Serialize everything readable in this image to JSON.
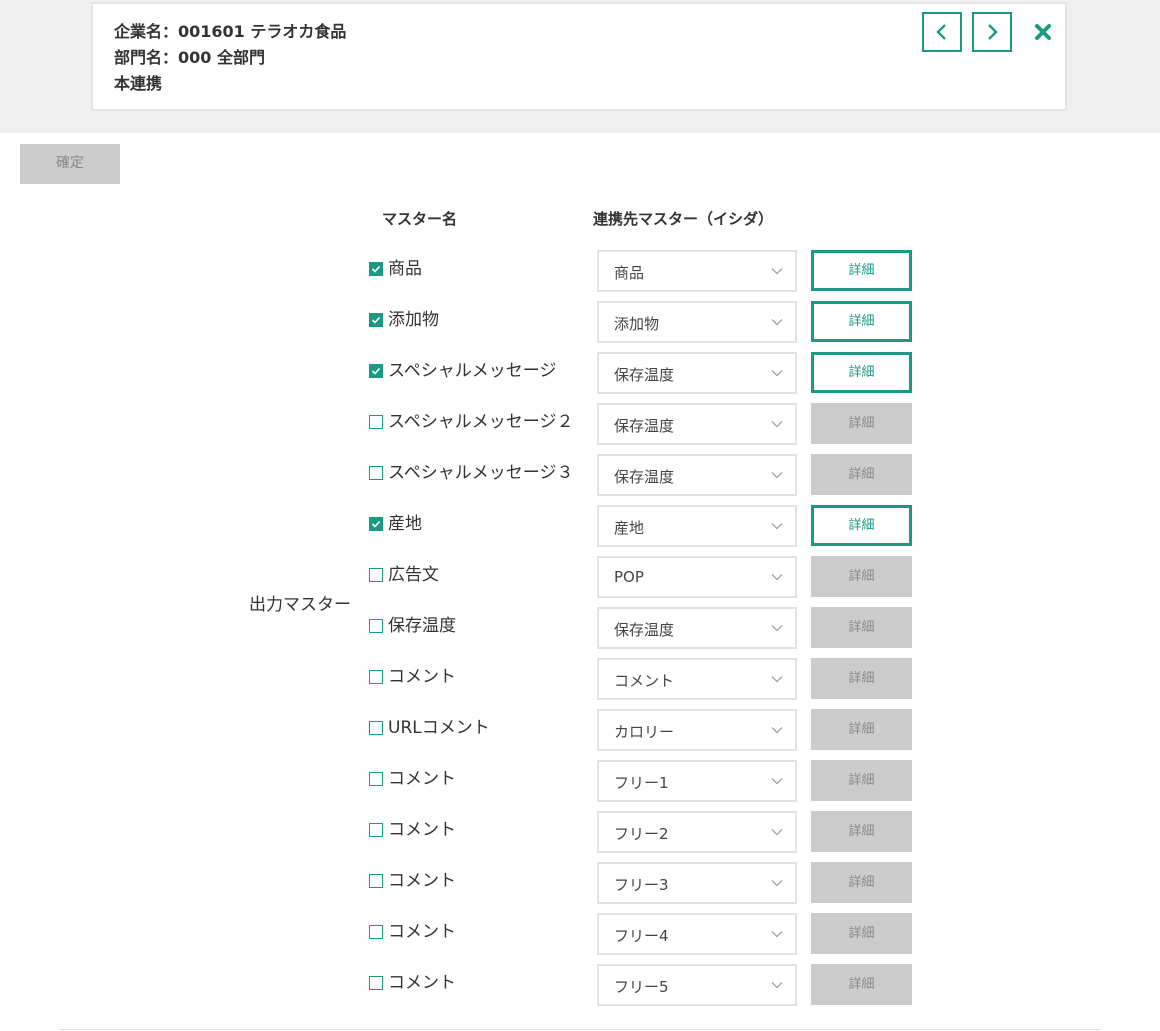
{
  "header": {
    "company": "企業名：001601 テラオカ食品",
    "department": "部門名：000 全部門",
    "mode": "本連携"
  },
  "icons": {
    "prev": "chevron-left-icon",
    "next": "chevron-right-icon",
    "close": "close-icon",
    "accent_color": "#1a9a85"
  },
  "confirm_label": "確定",
  "columns": {
    "master_name": "マスター名",
    "target_master": "連携先マスター（イシダ）"
  },
  "group_label": "出力マスター",
  "detail_label": "詳細",
  "rows": [
    {
      "checked": true,
      "label": "商品",
      "selected": "商品"
    },
    {
      "checked": true,
      "label": "添加物",
      "selected": "添加物"
    },
    {
      "checked": true,
      "label": "スペシャルメッセージ",
      "selected": "保存温度"
    },
    {
      "checked": false,
      "label": "スペシャルメッセージ２",
      "selected": "保存温度"
    },
    {
      "checked": false,
      "label": "スペシャルメッセージ３",
      "selected": "保存温度"
    },
    {
      "checked": true,
      "label": "産地",
      "selected": "産地"
    },
    {
      "checked": false,
      "label": "広告文",
      "selected": "POP"
    },
    {
      "checked": false,
      "label": "保存温度",
      "selected": "保存温度"
    },
    {
      "checked": false,
      "label": "コメント",
      "selected": "コメント"
    },
    {
      "checked": false,
      "label": "URLコメント",
      "selected": "カロリー"
    },
    {
      "checked": false,
      "label": "コメント",
      "selected": "フリー1"
    },
    {
      "checked": false,
      "label": "コメント",
      "selected": "フリー2"
    },
    {
      "checked": false,
      "label": "コメント",
      "selected": "フリー3"
    },
    {
      "checked": false,
      "label": "コメント",
      "selected": "フリー4"
    },
    {
      "checked": false,
      "label": "コメント",
      "selected": "フリー5"
    }
  ]
}
